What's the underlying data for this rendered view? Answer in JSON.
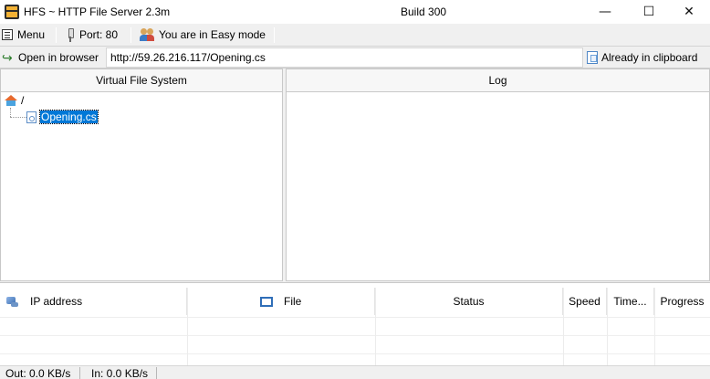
{
  "window": {
    "title": "HFS ~ HTTP File Server 2.3m",
    "build": "Build 300",
    "minimize_symbol": "—",
    "maximize_symbol": "☐",
    "close_symbol": "✕"
  },
  "toolbar": {
    "menu_label": "Menu",
    "port_label": "Port: 80",
    "mode_label": "You are in Easy mode"
  },
  "urlbar": {
    "open_browser_label": "Open in browser",
    "url_value": "http://59.26.216.117/Opening.cs",
    "clipboard_label": "Already in clipboard"
  },
  "vfs": {
    "header": "Virtual File System",
    "root_label": "/",
    "files": [
      {
        "name": "Opening.cs",
        "selected": true
      }
    ]
  },
  "log": {
    "header": "Log"
  },
  "connections": {
    "columns": [
      "IP address",
      "File",
      "Status",
      "Speed",
      "Time...",
      "Progress"
    ],
    "rows": []
  },
  "status": {
    "out": "Out: 0.0 KB/s",
    "in": "In: 0.0 KB/s"
  },
  "icons": [
    "hfs-app-icon",
    "menu-icon",
    "plug-icon",
    "users-icon",
    "arrow-icon",
    "clipboard-icon",
    "home-icon",
    "file-icon",
    "network-icon",
    "file-column-icon"
  ],
  "colors": {
    "selection": "#0078d7",
    "background": "#f0f0f0",
    "pane_background": "#ffffff"
  }
}
